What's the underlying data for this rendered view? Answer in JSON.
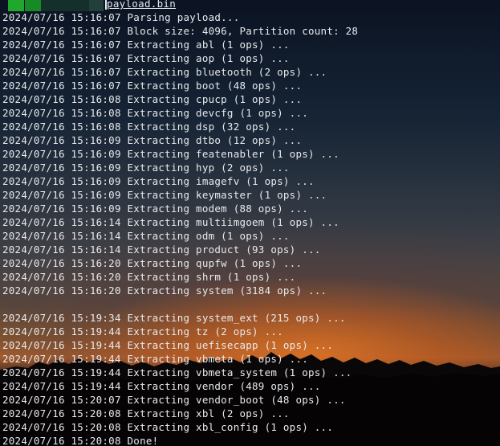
{
  "tab": {
    "filename": "payload.bin",
    "accent_color": "#1fa82c"
  },
  "log_lines": [
    "2024/07/16 15:16:07 Parsing payload...",
    "2024/07/16 15:16:07 Block size: 4096, Partition count: 28",
    "2024/07/16 15:16:07 Extracting abl (1 ops) ...",
    "2024/07/16 15:16:07 Extracting aop (1 ops) ...",
    "2024/07/16 15:16:07 Extracting bluetooth (2 ops) ...",
    "2024/07/16 15:16:07 Extracting boot (48 ops) ...",
    "2024/07/16 15:16:08 Extracting cpucp (1 ops) ...",
    "2024/07/16 15:16:08 Extracting devcfg (1 ops) ...",
    "2024/07/16 15:16:08 Extracting dsp (32 ops) ...",
    "2024/07/16 15:16:09 Extracting dtbo (12 ops) ...",
    "2024/07/16 15:16:09 Extracting featenabler (1 ops) ...",
    "2024/07/16 15:16:09 Extracting hyp (2 ops) ...",
    "2024/07/16 15:16:09 Extracting imagefv (1 ops) ...",
    "2024/07/16 15:16:09 Extracting keymaster (1 ops) ...",
    "2024/07/16 15:16:09 Extracting modem (88 ops) ...",
    "2024/07/16 15:16:14 Extracting multiimgoem (1 ops) ...",
    "2024/07/16 15:16:14 Extracting odm (1 ops) ...",
    "2024/07/16 15:16:14 Extracting product (93 ops) ...",
    "2024/07/16 15:16:20 Extracting qupfw (1 ops) ...",
    "2024/07/16 15:16:20 Extracting shrm (1 ops) ...",
    "2024/07/16 15:16:20 Extracting system (3184 ops) ...",
    "",
    "2024/07/16 15:19:34 Extracting system_ext (215 ops) ...",
    "2024/07/16 15:19:44 Extracting tz (2 ops) ...",
    "2024/07/16 15:19:44 Extracting uefisecapp (1 ops) ...",
    "2024/07/16 15:19:44 Extracting vbmeta (1 ops) ...",
    "2024/07/16 15:19:44 Extracting vbmeta_system (1 ops) ...",
    "2024/07/16 15:19:44 Extracting vendor (489 ops) ...",
    "2024/07/16 15:20:07 Extracting vendor_boot (48 ops) ...",
    "2024/07/16 15:20:08 Extracting xbl (2 ops) ...",
    "2024/07/16 15:20:08 Extracting xbl_config (1 ops) ...",
    "2024/07/16 15:20:08 Done!"
  ]
}
